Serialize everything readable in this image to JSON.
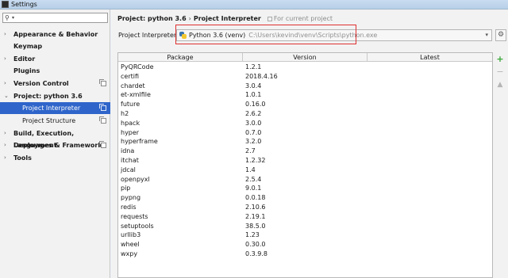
{
  "window": {
    "title": "Settings"
  },
  "sidebar": {
    "search_placeholder": "",
    "items": [
      {
        "label": "Appearance & Behavior",
        "arrow": "›"
      },
      {
        "label": "Keymap",
        "arrow": ""
      },
      {
        "label": "Editor",
        "arrow": "›"
      },
      {
        "label": "Plugins",
        "arrow": ""
      },
      {
        "label": "Version Control",
        "arrow": "›"
      },
      {
        "label": "Project: python 3.6",
        "arrow": "⌄"
      },
      {
        "label": "Project Interpreter",
        "arrow": ""
      },
      {
        "label": "Project Structure",
        "arrow": ""
      },
      {
        "label": "Build, Execution, Deployment",
        "arrow": "›"
      },
      {
        "label": "Languages & Frameworks",
        "arrow": "›"
      },
      {
        "label": "Tools",
        "arrow": "›"
      }
    ]
  },
  "breadcrumb": {
    "project": "Project: python 3.6",
    "separator": "›",
    "page": "Project Interpreter",
    "for_current": "For current project"
  },
  "interpreter": {
    "label": "Project Interpreter:",
    "name": "Python 3.6 (venv)",
    "path": "C:\\Users\\kevind\\venv\\Scripts\\python.exe"
  },
  "table": {
    "columns": [
      "Package",
      "Version",
      "Latest"
    ],
    "rows": [
      [
        "PyQRCode",
        "1.2.1",
        ""
      ],
      [
        "certifi",
        "2018.4.16",
        ""
      ],
      [
        "chardet",
        "3.0.4",
        ""
      ],
      [
        "et-xmlfile",
        "1.0.1",
        ""
      ],
      [
        "future",
        "0.16.0",
        ""
      ],
      [
        "h2",
        "2.6.2",
        ""
      ],
      [
        "hpack",
        "3.0.0",
        ""
      ],
      [
        "hyper",
        "0.7.0",
        ""
      ],
      [
        "hyperframe",
        "3.2.0",
        ""
      ],
      [
        "idna",
        "2.7",
        ""
      ],
      [
        "itchat",
        "1.2.32",
        ""
      ],
      [
        "jdcal",
        "1.4",
        ""
      ],
      [
        "openpyxl",
        "2.5.4",
        ""
      ],
      [
        "pip",
        "9.0.1",
        ""
      ],
      [
        "pypng",
        "0.0.18",
        ""
      ],
      [
        "redis",
        "2.10.6",
        ""
      ],
      [
        "requests",
        "2.19.1",
        ""
      ],
      [
        "setuptools",
        "38.5.0",
        ""
      ],
      [
        "urllib3",
        "1.23",
        ""
      ],
      [
        "wheel",
        "0.30.0",
        ""
      ],
      [
        "wxpy",
        "0.3.9.8",
        ""
      ]
    ]
  },
  "actions": {
    "add": "+",
    "remove": "−",
    "upgrade": "▲"
  },
  "colors": {
    "selection": "#2f65ca",
    "highlight_box": "#e03030",
    "add_icon": "#3aa83a"
  }
}
